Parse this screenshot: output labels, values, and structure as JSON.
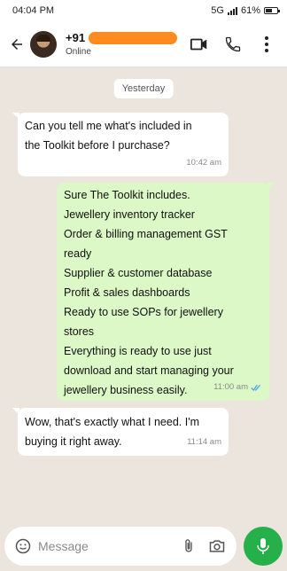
{
  "status_bar": {
    "time": "04:04 PM",
    "network": "5G",
    "battery": "61%",
    "battery_level": 0.61
  },
  "header": {
    "contact_name_prefix": "+91",
    "contact_status": "Online",
    "icons": [
      "back-arrow-icon",
      "video-call-icon",
      "phone-icon",
      "more-vertical-icon"
    ]
  },
  "chat": {
    "date_label": "Yesterday",
    "messages": [
      {
        "direction": "incoming",
        "lines": [
          "Can you tell me what's included in",
          "the Toolkit before I purchase?"
        ],
        "time": "10:42 am"
      },
      {
        "direction": "outgoing",
        "lines": [
          "Sure The Toolkit includes.",
          "Jewellery inventory tracker",
          "Order & billing management GST",
          "ready",
          "Supplier & customer database",
          "Profit & sales dashboards",
          "Ready to use SOPs for jewellery",
          "stores",
          "Everything is ready to use just",
          "download and start managing your",
          "jewellery business easily."
        ],
        "time": "11:00 am",
        "read_receipt": "double-check-blue"
      },
      {
        "direction": "incoming",
        "lines": [
          "Wow, that's exactly what I need. I'm",
          "buying it right away."
        ],
        "time": "11:14 am"
      }
    ]
  },
  "composer": {
    "placeholder": "Message"
  },
  "colors": {
    "chat_background": "#ece5dd",
    "outgoing_bubble": "#dcf8c6",
    "incoming_bubble": "#ffffff",
    "mic_button": "#25b04a",
    "read_tick": "#4fa6e8",
    "redaction": "#ff8a1f"
  }
}
